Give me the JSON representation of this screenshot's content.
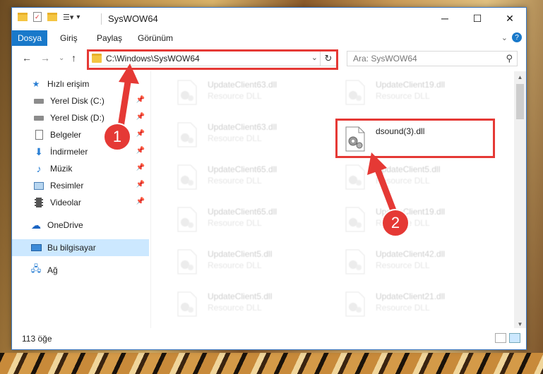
{
  "window": {
    "title": "SysWOW64"
  },
  "ribbon": {
    "tabs": [
      "Dosya",
      "Giriş",
      "Paylaş",
      "Görünüm"
    ]
  },
  "address_bar": {
    "path": "C:\\Windows\\SysWOW64"
  },
  "search": {
    "placeholder": "Ara: SysWOW64"
  },
  "sidebar": {
    "items": [
      {
        "label": "Hızlı erişim",
        "icon": "star-icon"
      },
      {
        "label": "Yerel Disk (C:)",
        "icon": "drive-icon",
        "pinned": true
      },
      {
        "label": "Yerel Disk (D:)",
        "icon": "drive-icon",
        "pinned": true
      },
      {
        "label": "Belgeler",
        "icon": "documents-icon",
        "pinned": true
      },
      {
        "label": "İndirmeler",
        "icon": "download-icon",
        "pinned": true
      },
      {
        "label": "Müzik",
        "icon": "music-icon",
        "pinned": true
      },
      {
        "label": "Resimler",
        "icon": "pictures-icon",
        "pinned": true
      },
      {
        "label": "Videolar",
        "icon": "videos-icon",
        "pinned": true
      },
      {
        "label": "OneDrive",
        "icon": "cloud-icon"
      },
      {
        "label": "Bu bilgisayar",
        "icon": "computer-icon",
        "selected": true
      },
      {
        "label": "Ağ",
        "icon": "network-icon"
      }
    ]
  },
  "files": [
    {
      "name": "UpdateClient63.dll",
      "type": "Resource DLL"
    },
    {
      "name": "UpdateClient19.dll",
      "type": "Resource DLL"
    },
    {
      "name": "UpdateClient63.dll",
      "type": "Resource DLL"
    },
    {
      "name": "dsound(3).dll",
      "type": ""
    },
    {
      "name": "UpdateClient65.dll",
      "type": "Resource DLL"
    },
    {
      "name": "UpdateClient5.dll",
      "type": "Resource DLL"
    },
    {
      "name": "UpdateClient65.dll",
      "type": "Resource DLL"
    },
    {
      "name": "UpdateClient19.dll",
      "type": "Resource DLL"
    },
    {
      "name": "UpdateClient5.dll",
      "type": "Resource DLL"
    },
    {
      "name": "UpdateClient42.dll",
      "type": "Resource DLL"
    },
    {
      "name": "UpdateClient5.dll",
      "type": "Resource DLL"
    },
    {
      "name": "UpdateClient21.dll",
      "type": "Resource DLL"
    }
  ],
  "status": {
    "count": "113 öğe"
  },
  "annotations": {
    "step1": "1",
    "step2": "2",
    "color": "#e53935"
  },
  "colors": {
    "accent": "#1979ca",
    "selected": "#cce8ff",
    "highlight": "#e53935"
  }
}
